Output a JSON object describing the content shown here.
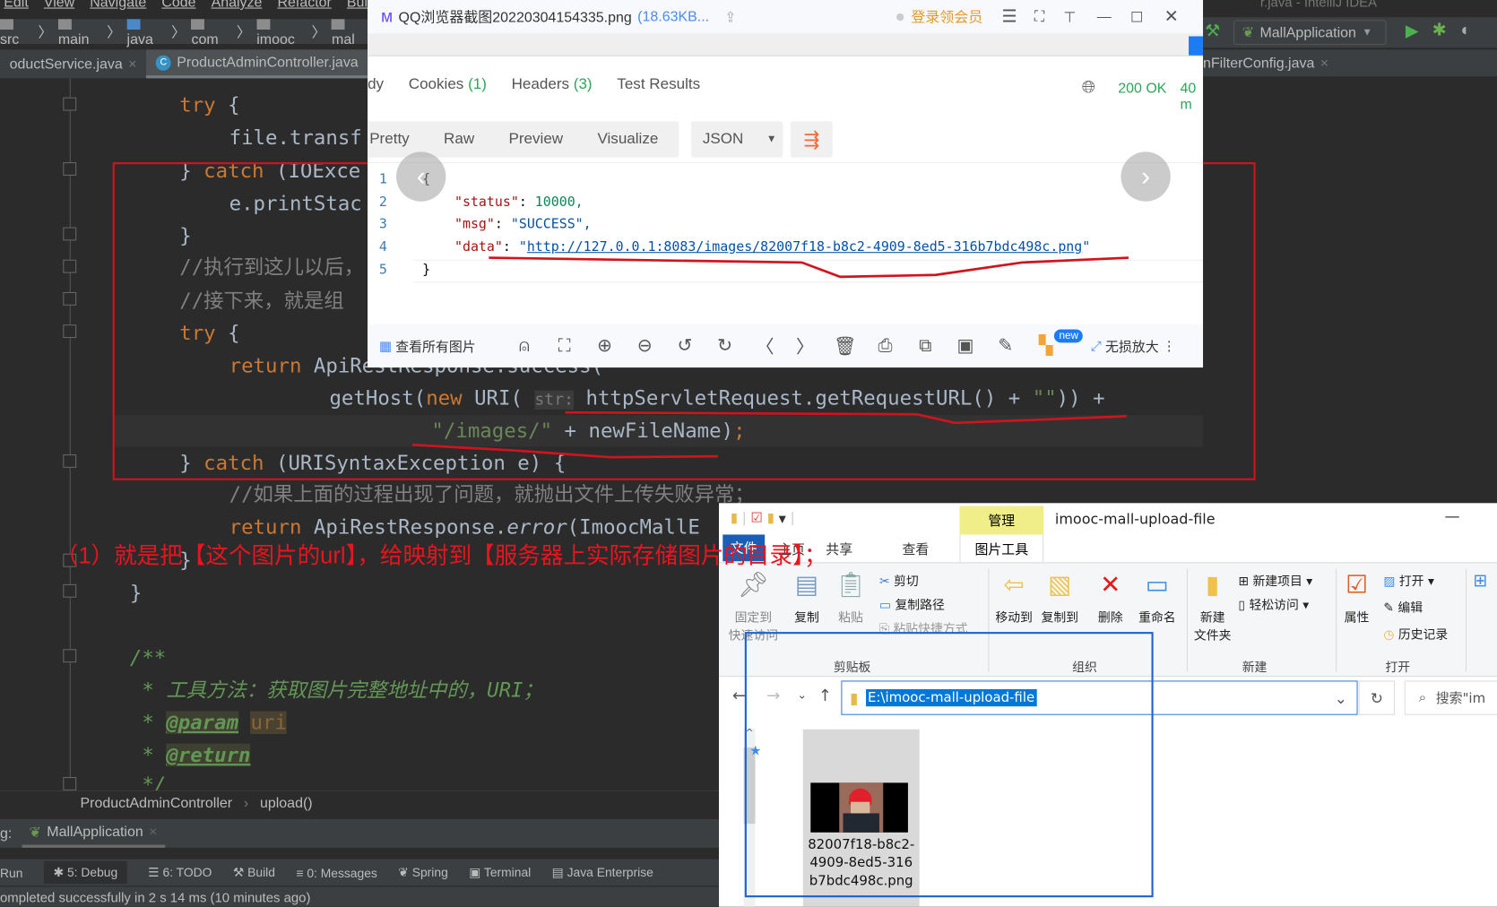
{
  "ide": {
    "menu": [
      "Edit",
      "View",
      "Navigate",
      "Code",
      "Analyze",
      "Refactor",
      "Buil"
    ],
    "window_title": "r.java - IntelliJ IDEA",
    "breadcrumb": [
      "src",
      "main",
      "java",
      "com",
      "imooc",
      "mal"
    ],
    "tabs": [
      {
        "label": "oductService.java",
        "close": "×"
      },
      {
        "label": "ProductAdminController.java",
        "icon": "C"
      }
    ],
    "right_tab": {
      "label": "nFilterConfig.java",
      "close": "×"
    },
    "run_config": "MallApplication",
    "code_lines": [
      {
        "tokens": [
          [
            "k",
            "try"
          ],
          [
            "t",
            " {"
          ]
        ]
      },
      {
        "tokens": [
          [
            "t",
            "file.transf"
          ]
        ]
      },
      {
        "tokens": [
          [
            "t",
            "} "
          ],
          [
            "k",
            "catch"
          ],
          [
            "t",
            " (IOExce"
          ]
        ]
      },
      {
        "tokens": [
          [
            "t",
            "e.printStac"
          ]
        ]
      },
      {
        "tokens": [
          [
            "t",
            "}"
          ]
        ]
      },
      {
        "tokens": [
          [
            "c",
            "//执行到这儿以后，"
          ]
        ]
      },
      {
        "tokens": [
          [
            "c",
            "//接下来，就是组"
          ]
        ]
      },
      {
        "tokens": [
          [
            "k",
            "try"
          ],
          [
            "t",
            " {"
          ]
        ]
      },
      {
        "tokens": [
          [
            "k",
            "return"
          ],
          [
            "t",
            " ApiRestResponse.success("
          ]
        ]
      },
      {
        "tokens": [
          [
            "t",
            "getHost("
          ],
          [
            "k",
            "new"
          ],
          [
            "t",
            " URI( "
          ],
          [
            "h",
            "str:"
          ],
          [
            "t",
            " httpServletRequest.getRequestURL() + "
          ],
          [
            "s",
            "\"\""
          ],
          [
            "t",
            ")) +"
          ]
        ]
      },
      {
        "tokens": [
          [
            "s",
            "\"/images/\""
          ],
          [
            "t",
            " + newFileName)"
          ],
          [
            "k",
            ";"
          ]
        ]
      },
      {
        "tokens": [
          [
            "t",
            "} "
          ],
          [
            "k",
            "catch"
          ],
          [
            "t",
            " (URISyntaxException e) {"
          ]
        ]
      },
      {
        "tokens": [
          [
            "c",
            "//如果上面的过程出现了问题，就抛出文件上传失败异常；"
          ]
        ]
      },
      {
        "tokens": [
          [
            "k",
            "return"
          ],
          [
            "t",
            " ApiRestResponse."
          ],
          [
            "t",
            "error"
          ],
          [
            "t",
            "(ImoocMallE"
          ]
        ]
      },
      {
        "tokens": [
          [
            "t",
            "}"
          ]
        ]
      },
      {
        "tokens": [
          [
            "t",
            "}"
          ]
        ]
      },
      {
        "tokens": [
          [
            "d",
            "/**"
          ]
        ]
      },
      {
        "tokens": [
          [
            "d",
            " * 工具方法：获取图片完整地址中的，URI；"
          ]
        ]
      },
      {
        "tokens": [
          [
            "d",
            " * "
          ],
          [
            "tag",
            "@param"
          ],
          [
            "d",
            " "
          ],
          [
            "pv",
            "uri"
          ]
        ]
      },
      {
        "tokens": [
          [
            "d",
            " * "
          ],
          [
            "tag",
            "@return"
          ]
        ]
      },
      {
        "tokens": [
          [
            "d",
            " */"
          ]
        ]
      }
    ],
    "bottom_breadcrumb": [
      "ProductAdminController",
      "upload()"
    ],
    "debug_label": "g:",
    "debug_tab": "MallApplication",
    "tool_windows": [
      "Run",
      "5: Debug",
      "6: TODO",
      "Build",
      "0: Messages",
      "Spring",
      "Terminal",
      "Java Enterprise"
    ],
    "status": "ompleted successfully in 2 s 14 ms (10 minutes ago)"
  },
  "viewer": {
    "title": "QQ浏览器截图20220304154335.png",
    "size": "(18.63KB...",
    "login": "登录领会员",
    "response_tabs": [
      {
        "label": "dy"
      },
      {
        "label": "Cookies",
        "count": "(1)"
      },
      {
        "label": "Headers",
        "count": "(3)"
      },
      {
        "label": "Test Results"
      }
    ],
    "status_code": "200 OK",
    "time": "40 m",
    "view_modes": [
      "Pretty",
      "Raw",
      "Preview",
      "Visualize"
    ],
    "format": "JSON",
    "json_lines": [
      {
        "n": "1",
        "text": "{"
      },
      {
        "n": "2",
        "key": "\"status\"",
        "value": "10000,",
        "vtype": "num"
      },
      {
        "n": "3",
        "key": "\"msg\"",
        "value": "\"SUCCESS\",",
        "vtype": "str"
      },
      {
        "n": "4",
        "key": "\"data\"",
        "value": "http://127.0.0.1:8083/images/82007f18-b8c2-4909-8ed5-316b7bdc498c.png",
        "vtype": "url"
      },
      {
        "n": "5",
        "text": "}"
      }
    ],
    "toolbar": {
      "all_images": "查看所有图片",
      "new_badge": "new",
      "lossless": "无损放大"
    }
  },
  "annotation": "（1）就是把【这个图片的url】，给映射到【服务器上实际存储图片的目录】；",
  "explorer": {
    "title": "imooc-mall-upload-file",
    "context_tab": "管理",
    "ribbon_tabs": [
      "文件",
      "主页",
      "共享",
      "查看",
      "图片工具"
    ],
    "buttons": {
      "pin": "固定到\n快速访问",
      "copy": "复制",
      "paste": "粘贴",
      "cut": "剪切",
      "copy_path": "复制路径",
      "paste_shortcut": "粘贴快捷方式",
      "move_to": "移动到",
      "copy_to": "复制到",
      "delete": "删除",
      "rename": "重命名",
      "new_folder": "新建\n文件夹",
      "new_item": "新建项目",
      "easy_access": "轻松访问",
      "properties": "属性",
      "open": "打开",
      "edit": "编辑",
      "history": "历史记录"
    },
    "groups": [
      "剪贴板",
      "组织",
      "新建",
      "打开"
    ],
    "address": "E:\\imooc-mall-upload-file",
    "search_placeholder": "搜索\"im",
    "file_name": "82007f18-b8c2-4909-8ed5-316b7bdc498c.png",
    "file_name_lines": [
      "82007f18-b8c2-",
      "4909-8ed5-316",
      "b7bdc498c.png"
    ]
  },
  "colors": {
    "annotation_red": "#e8141e",
    "highlight_blue": "#1e64d0",
    "keyword": "#cc7832",
    "string": "#6a8759",
    "status_green": "#2fa55a"
  }
}
